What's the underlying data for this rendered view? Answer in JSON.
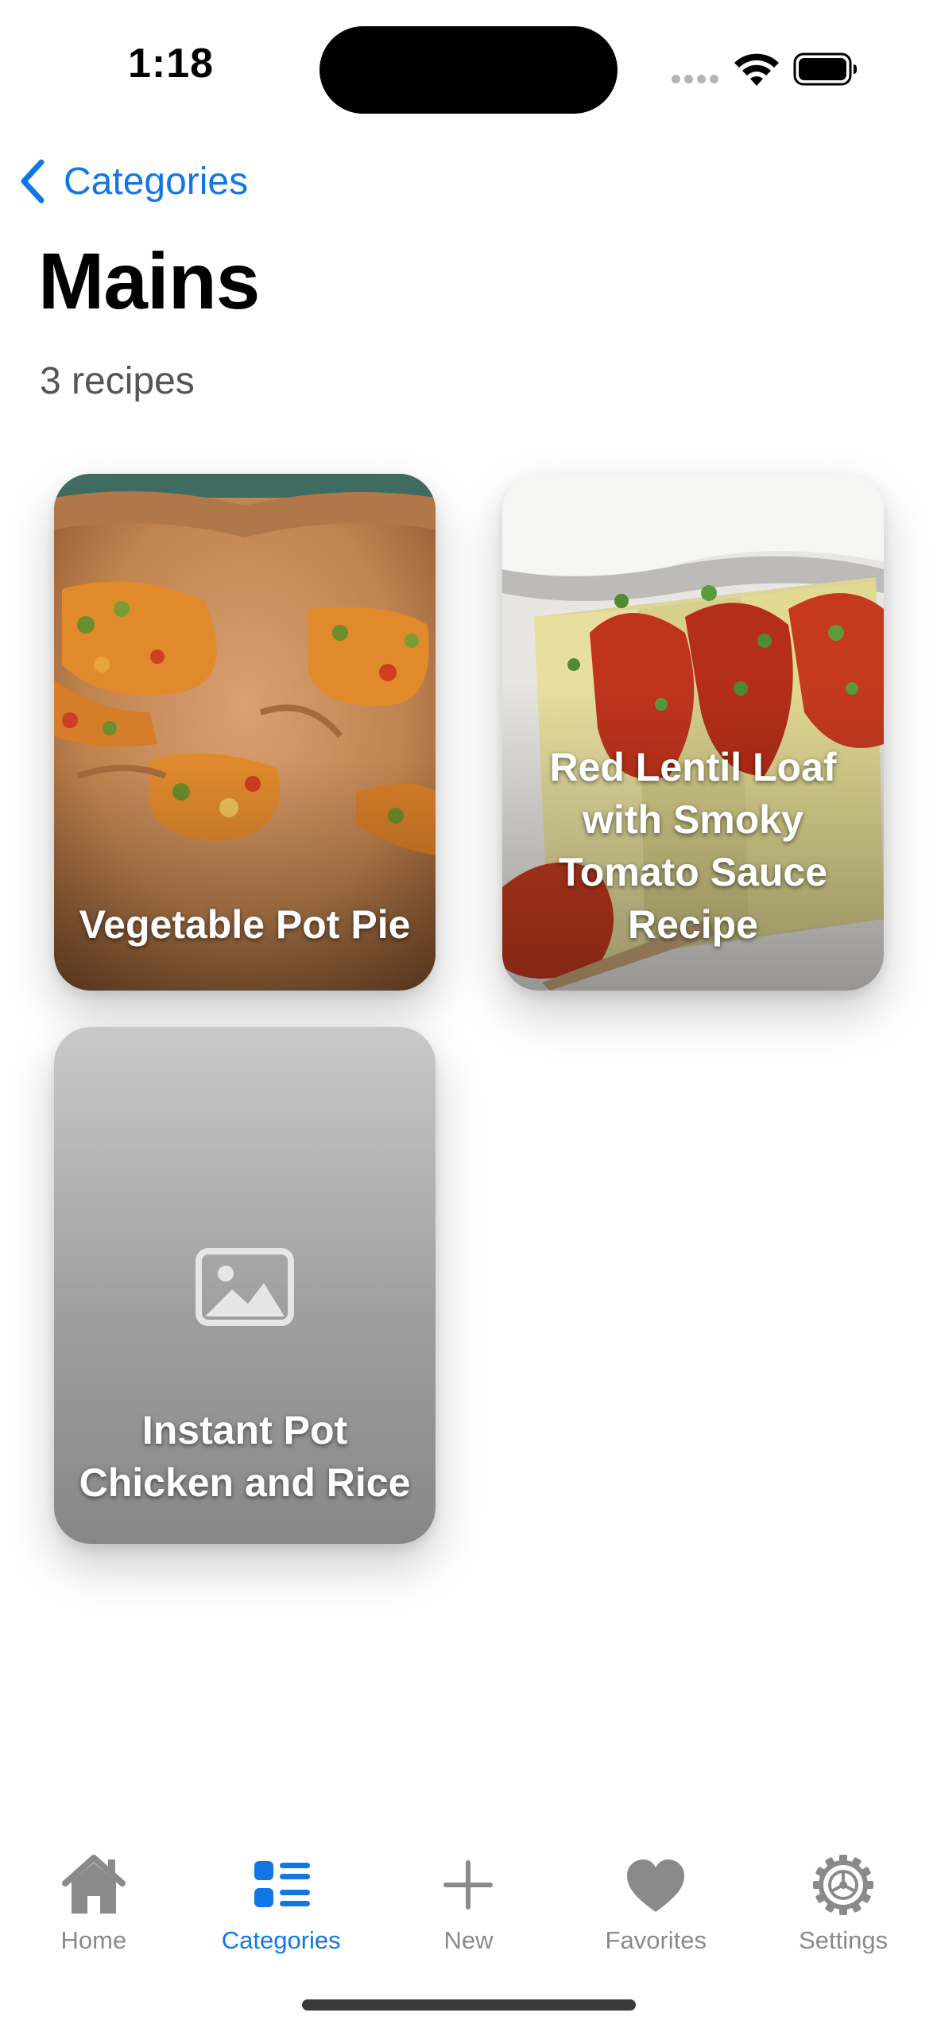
{
  "status_bar": {
    "time": "1:18"
  },
  "nav": {
    "back_label": "Categories"
  },
  "page": {
    "title": "Mains",
    "subtitle": "3 recipes"
  },
  "recipes": [
    {
      "title": "Vegetable Pot Pie",
      "has_image": true
    },
    {
      "title": "Red Lentil Loaf with Smoky Tomato Sauce Recipe",
      "has_image": true
    },
    {
      "title": "Instant Pot Chicken and Rice",
      "has_image": false
    }
  ],
  "tab_bar": {
    "items": [
      {
        "label": "Home",
        "icon": "house-icon",
        "active": false
      },
      {
        "label": "Categories",
        "icon": "list-icon",
        "active": true
      },
      {
        "label": "New",
        "icon": "plus-icon",
        "active": false
      },
      {
        "label": "Favorites",
        "icon": "heart-icon",
        "active": false
      },
      {
        "label": "Settings",
        "icon": "gear-icon",
        "active": false
      }
    ]
  },
  "colors": {
    "accent": "#1277e6",
    "inactive": "#8a8a8a"
  }
}
